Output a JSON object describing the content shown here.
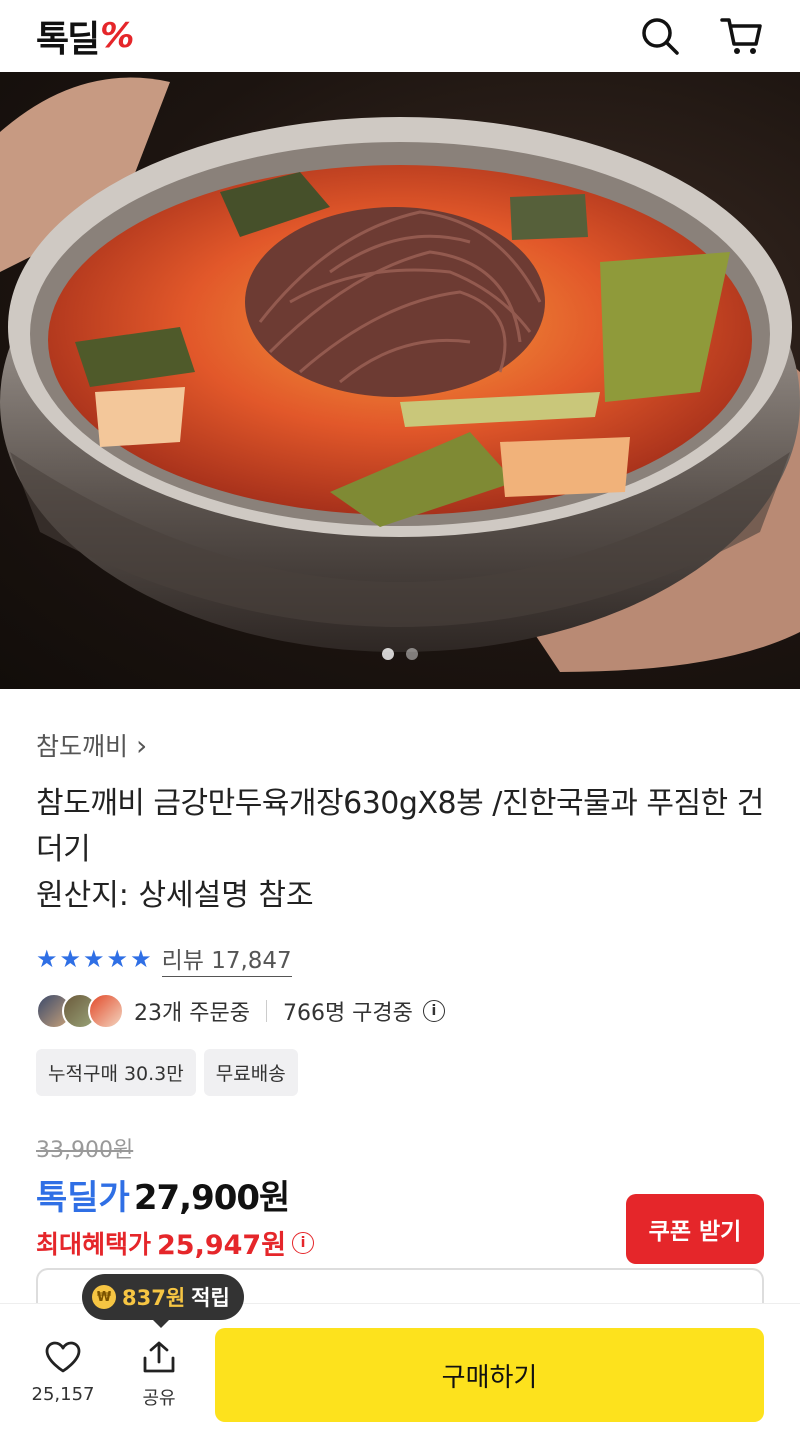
{
  "header": {
    "logo_text": "톡딜",
    "logo_symbol": "%",
    "icons": [
      "search-icon",
      "cart-icon"
    ],
    "accent_color": "#e5262a"
  },
  "hero": {
    "page_total": 2,
    "page_active": 1
  },
  "product": {
    "brand": "참도깨비",
    "brand_chevron": "›",
    "title": "참도깨비 금강만두육개장630gX8봉 /진한국물과 푸짐한 건더기",
    "origin": "원산지: 상세설명 참조",
    "rating_stars": 5,
    "review_text": "리뷰 17,847",
    "social": {
      "orders": "23개 주문중",
      "viewers": "766명 구경중"
    },
    "tags": [
      "누적구매 30.3만",
      "무료배송"
    ]
  },
  "price": {
    "original": "33,900원",
    "deal_label": "톡딜가",
    "deal_price": "27,900원",
    "max_label": "최대혜택가",
    "max_price": "25,947원",
    "coupon_button": "쿠폰 받기",
    "deal_color": "#2f6fe5"
  },
  "tooltip": {
    "coin_symbol": "₩",
    "amount": "837원",
    "suffix": "적립"
  },
  "bottom_bar": {
    "like_count": "25,157",
    "share_label": "공유",
    "buy_button": "구매하기",
    "buy_color": "#fde21d"
  }
}
